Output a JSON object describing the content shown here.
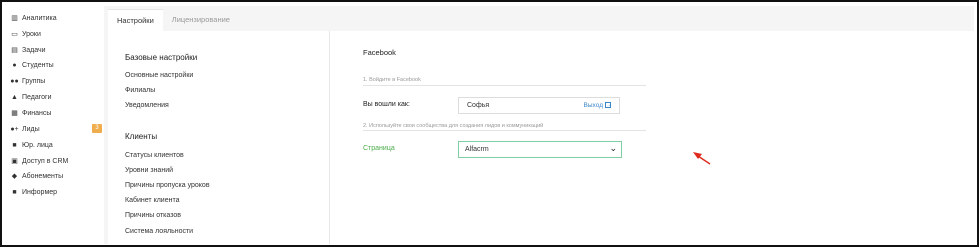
{
  "sidebar": {
    "items": [
      {
        "icon": "chart-icon",
        "glyph": "▥",
        "label": "Аналитика"
      },
      {
        "icon": "monitor-icon",
        "glyph": "▭",
        "label": "Уроки"
      },
      {
        "icon": "tasks-icon",
        "glyph": "▤",
        "label": "Задачи"
      },
      {
        "icon": "user-icon",
        "glyph": "●",
        "label": "Студенты"
      },
      {
        "icon": "users-icon",
        "glyph": "●●",
        "label": "Группы"
      },
      {
        "icon": "graduation-cap-icon",
        "glyph": "▲",
        "label": "Педагоги"
      },
      {
        "icon": "money-icon",
        "glyph": "▦",
        "label": "Финансы"
      },
      {
        "icon": "user-plus-icon",
        "glyph": "●+",
        "label": "Лиды",
        "badge": "3"
      },
      {
        "icon": "briefcase-icon",
        "glyph": "■",
        "label": "Юр. лица"
      },
      {
        "icon": "lock-icon",
        "glyph": "▣",
        "label": "Доступ в CRM"
      },
      {
        "icon": "tag-icon",
        "glyph": "◆",
        "label": "Абонементы"
      },
      {
        "icon": "informer-icon",
        "glyph": "■",
        "label": "Информер"
      }
    ]
  },
  "tabs": [
    {
      "label": "Настройки",
      "active": true
    },
    {
      "label": "Лицензирование",
      "active": false
    }
  ],
  "settings": {
    "base_title": "Базовые настройки",
    "base_links": [
      "Основные настройки",
      "Филиалы",
      "Уведомления"
    ],
    "clients_title": "Клиенты",
    "clients_links": [
      "Статусы клиентов",
      "Уровни знаний",
      "Причины пропуска уроков",
      "Кабинет клиента",
      "Причины отказов",
      "Система лояльности"
    ]
  },
  "facebook": {
    "title": "Facebook",
    "step1": "1. Войдите в Facebook",
    "logged_in_label": "Вы вошли как:",
    "user_name": "Софья",
    "logout_label": "Выход",
    "step2": "2. Используйте свои сообщества для создания лидов и коммуникаций",
    "page_label": "Страница",
    "page_value": "Alfacrm"
  },
  "colors": {
    "badge": "#f0ad4e",
    "link_blue": "#3a86c8",
    "green_label": "#4cae4c",
    "arrow_red": "#e0291d"
  }
}
